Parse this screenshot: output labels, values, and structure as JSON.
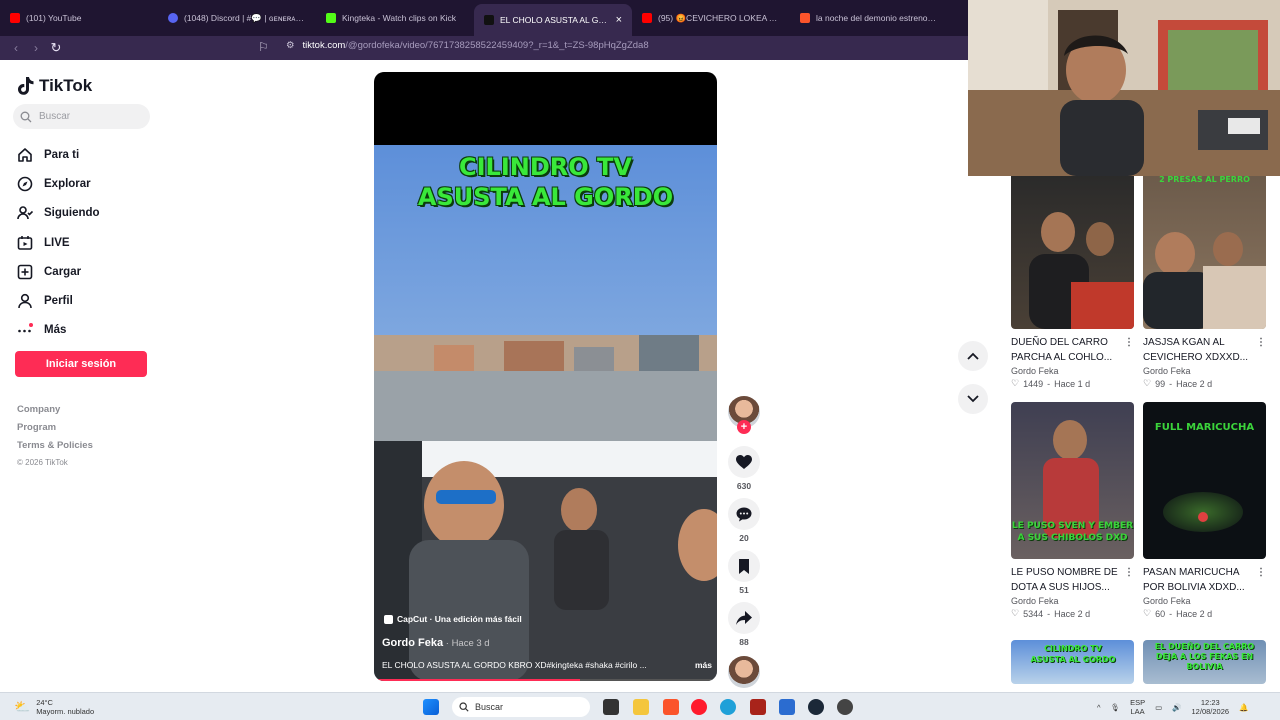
{
  "browser": {
    "tabs": [
      {
        "title": "(101) YouTube",
        "color": "#ff0000"
      },
      {
        "title": "(1048) Discord | #💬 | ɢᴇɴᴇʀᴀʟ | ESU",
        "color": "#5865f2"
      },
      {
        "title": "Kingteka - Watch clips on Kick",
        "color": "#53fc18"
      },
      {
        "title": "EL CHOLO ASUSTA AL GORDO",
        "color": "#ffffff",
        "active": true,
        "close": "×"
      },
      {
        "title": "(95) 😡CEVICHERO LOKEA A SHAKA",
        "color": "#ff0000"
      },
      {
        "title": "la noche del demonio estreno - Bra",
        "color": "#fb542b"
      }
    ],
    "url_host": "tiktok.com",
    "url_path": "/@gordofeka/video/7671738258522459409?_r=1&_t=ZS-98pHqZgZda8"
  },
  "sidebar": {
    "logo": "TikTok",
    "search_placeholder": "Buscar",
    "nav": [
      {
        "label": "Para ti",
        "icon": "home-icon"
      },
      {
        "label": "Explorar",
        "icon": "compass-icon"
      },
      {
        "label": "Siguiendo",
        "icon": "following-icon"
      },
      {
        "label": "LIVE",
        "icon": "live-icon"
      },
      {
        "label": "Cargar",
        "icon": "upload-icon"
      },
      {
        "label": "Perfil",
        "icon": "profile-icon"
      },
      {
        "label": "Más",
        "icon": "more-icon"
      }
    ],
    "login_label": "Iniciar sesión",
    "footer": [
      "Company",
      "Program",
      "Terms & Policies"
    ],
    "copyright": "© 2026 TikTok"
  },
  "video": {
    "overlay_line1": "CILINDRO TV",
    "overlay_line2": "ASUSTA AL GORDO",
    "capcut": "CapCut · Una edición más fácil",
    "author": "Gordo Feka",
    "ago": " · Hace 3 d",
    "description": "EL CHOLO ASUSTA AL GORDO KBRO XD#kingteka #shaka #cirilo ...",
    "more": "más",
    "progress": 0.6
  },
  "actions": {
    "likes": "630",
    "comments": "20",
    "saves": "51",
    "shares": "88"
  },
  "grid": [
    {
      "title": "DUEÑO DEL CARRO PARCHA AL COHLO...",
      "author": "Gordo Feka",
      "likes": "1449",
      "ago": "Hace 1 d",
      "overlay": "",
      "bg": "#3a3a3a"
    },
    {
      "title": "JASJSA KGAN AL CEVICHERO XDXXD...",
      "author": "Gordo Feka",
      "likes": "99",
      "ago": "Hace 2 d",
      "overlay": "2 PRESAS AL PERRO",
      "bg": "#5a4a3e"
    },
    {
      "title": "LE PUSO NOMBRE DE DOTA A SUS HIJOS...",
      "author": "Gordo Feka",
      "likes": "5344",
      "ago": "Hace 2 d",
      "overlay": "LE PUSO SVEN Y EMBER A SUS CHIBOLOS DXD",
      "bg": "#4b4f5e"
    },
    {
      "title": "PASAN MARICUCHA POR BOLIVIA XDXD...",
      "author": "Gordo Feka",
      "likes": "60",
      "ago": "Hace 2 d",
      "overlay": "FULL MARICUCHA",
      "bg": "#101418"
    },
    {
      "title": "",
      "author": "",
      "likes": "",
      "ago": "",
      "overlay": "CILINDRO TV ASUSTA AL GORDO",
      "bg": "#7fa7d6"
    },
    {
      "title": "",
      "author": "",
      "likes": "",
      "ago": "",
      "overlay": "EL DUEÑO DEL CARRO DEJA A LOS FEKAS EN BOLIVIA",
      "bg": "#6f8fb4"
    }
  ],
  "taskbar": {
    "temp": "24°C",
    "weather": "Mayorm. nublado",
    "search": "Buscar",
    "lang1": "ESP",
    "lang2": "LAA",
    "time": "12:23",
    "date": "12/08/2026"
  },
  "colors": {
    "accent": "#fe2c55",
    "overlay_green": "#39e83a"
  }
}
